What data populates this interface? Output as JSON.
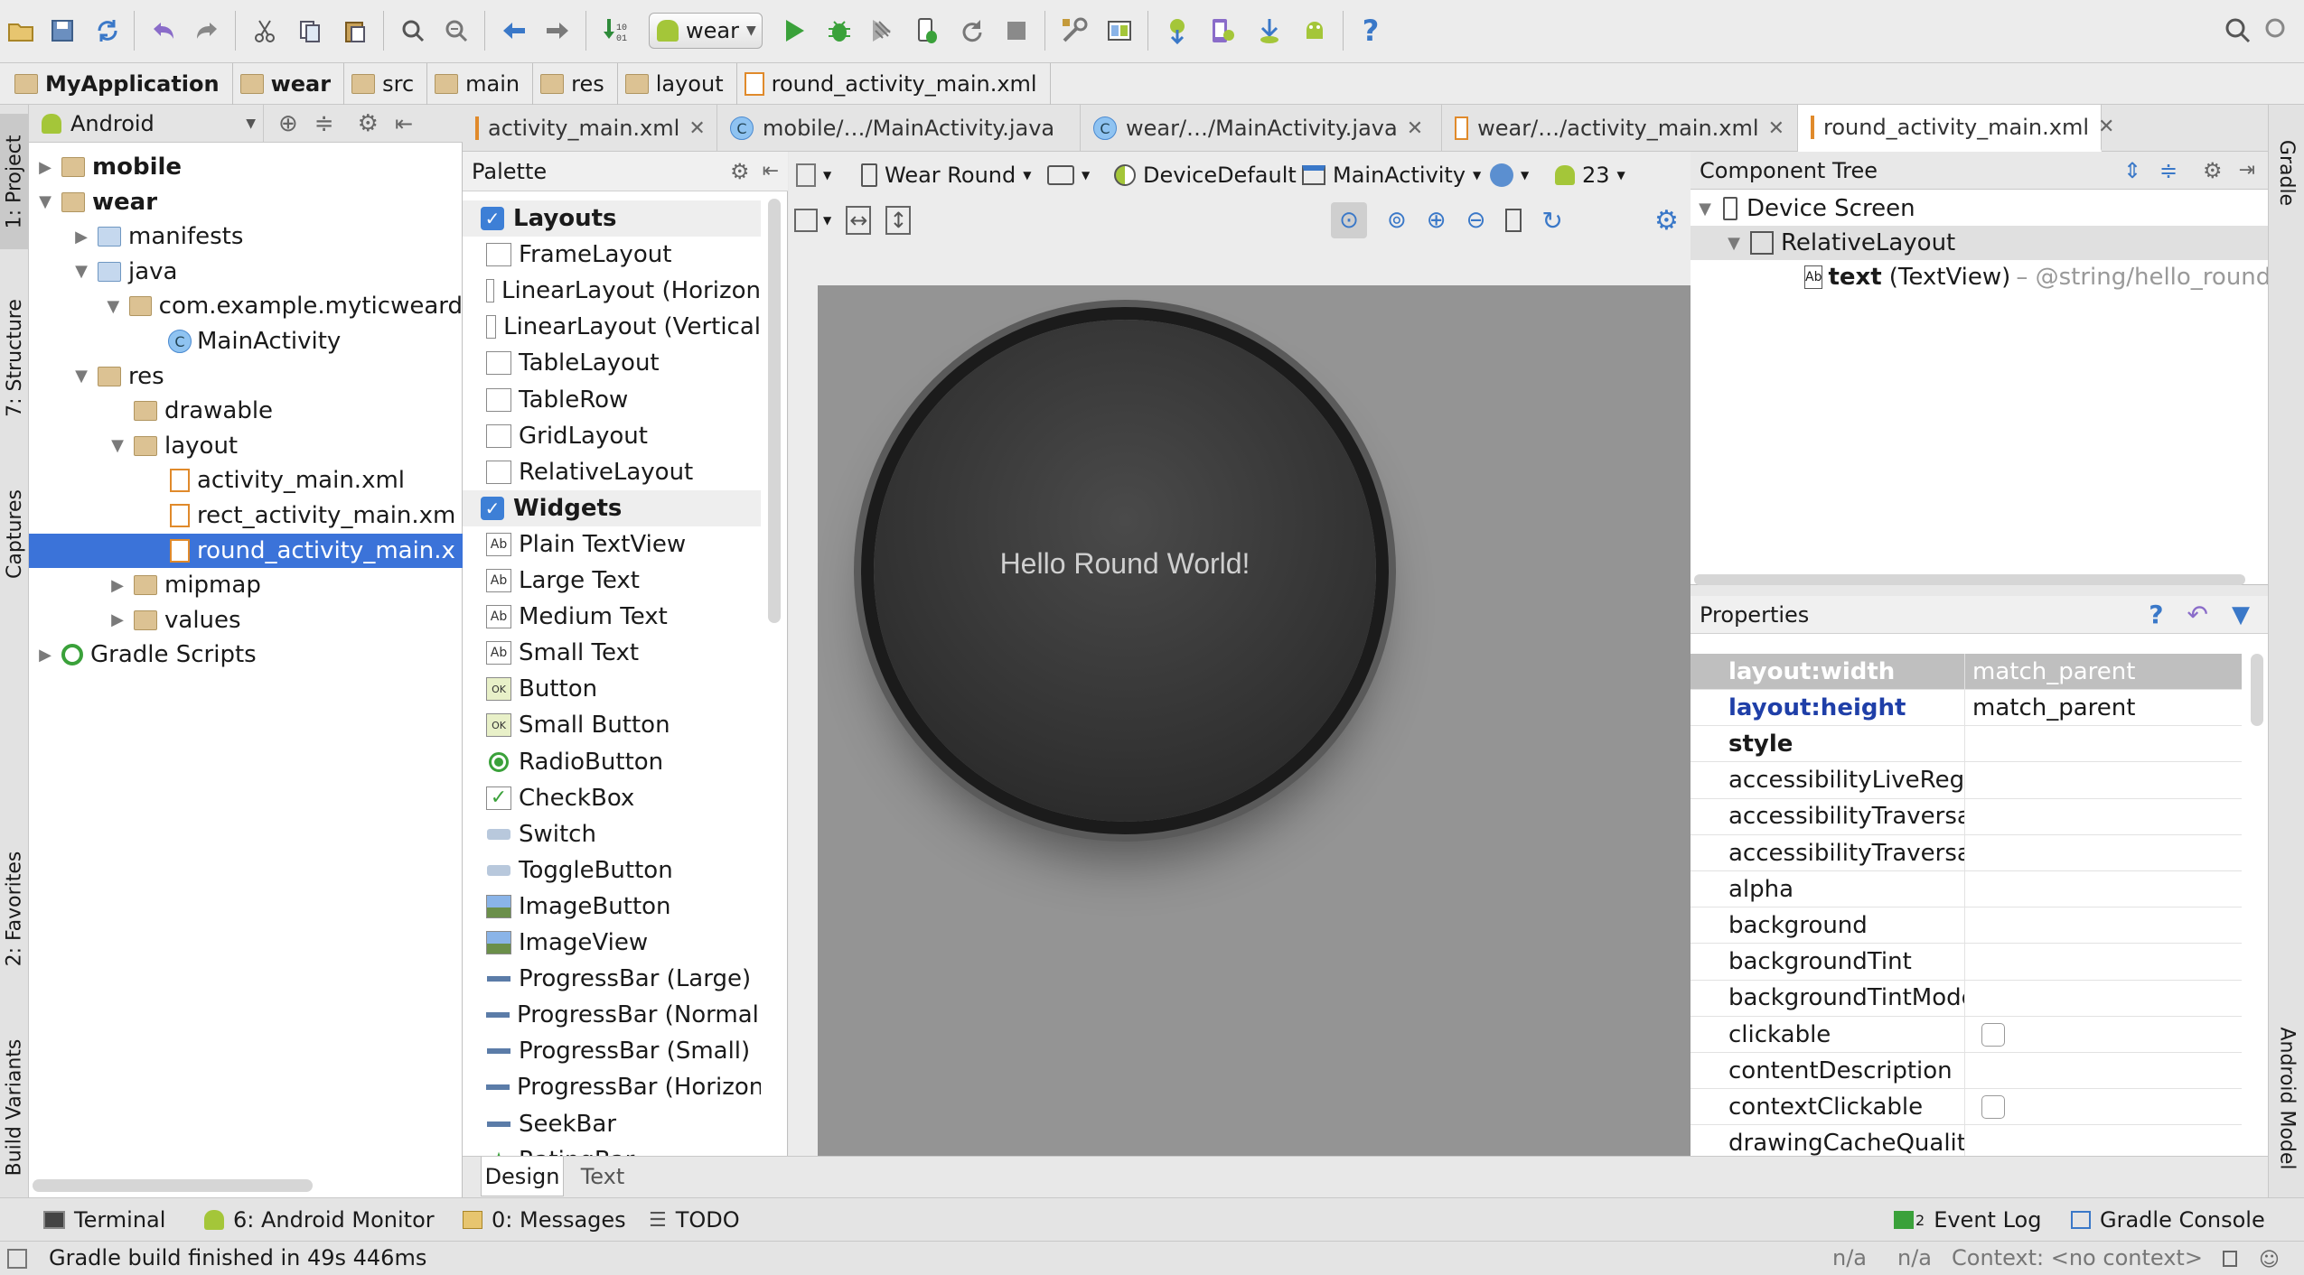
{
  "toolbar": {
    "run_config": "wear"
  },
  "breadcrumb": [
    "MyApplication",
    "wear",
    "src",
    "main",
    "res",
    "layout",
    "round_activity_main.xml"
  ],
  "project_panel": {
    "view_mode": "Android",
    "tree": [
      {
        "label": "mobile",
        "level": 0,
        "bold": true,
        "expanded": false,
        "icon": "module-folder"
      },
      {
        "label": "wear",
        "level": 0,
        "bold": true,
        "expanded": true,
        "icon": "module-folder"
      },
      {
        "label": "manifests",
        "level": 1,
        "expanded": false,
        "icon": "folder-blue"
      },
      {
        "label": "java",
        "level": 1,
        "expanded": true,
        "icon": "folder-blue"
      },
      {
        "label": "com.example.myticweard",
        "level": 2,
        "expanded": true,
        "icon": "package-folder"
      },
      {
        "label": "MainActivity",
        "level": 3,
        "icon": "class"
      },
      {
        "label": "res",
        "level": 1,
        "expanded": true,
        "icon": "res-folder"
      },
      {
        "label": "drawable",
        "level": 2,
        "icon": "folder"
      },
      {
        "label": "layout",
        "level": 2,
        "expanded": true,
        "icon": "folder"
      },
      {
        "label": "activity_main.xml",
        "level": 3,
        "icon": "xml"
      },
      {
        "label": "rect_activity_main.xm",
        "level": 3,
        "icon": "xml"
      },
      {
        "label": "round_activity_main.x",
        "level": 3,
        "icon": "xml",
        "selected": true
      },
      {
        "label": "mipmap",
        "level": 2,
        "expanded": false,
        "icon": "folder"
      },
      {
        "label": "values",
        "level": 2,
        "expanded": false,
        "icon": "folder"
      },
      {
        "label": "Gradle Scripts",
        "level": 0,
        "expanded": false,
        "icon": "gradle"
      }
    ]
  },
  "editor_tabs": [
    {
      "label": "activity_main.xml",
      "icon": "xml"
    },
    {
      "label": "mobile/…/MainActivity.java",
      "icon": "class"
    },
    {
      "label": "wear/…/MainActivity.java",
      "icon": "class"
    },
    {
      "label": "wear/…/activity_main.xml",
      "icon": "xml"
    },
    {
      "label": "round_activity_main.xml",
      "icon": "xml",
      "active": true
    }
  ],
  "palette": {
    "title": "Palette",
    "items": [
      {
        "label": "Layouts",
        "header": true
      },
      {
        "label": "FrameLayout",
        "icon": "frame"
      },
      {
        "label": "LinearLayout (Horizon",
        "icon": "linear-h"
      },
      {
        "label": "LinearLayout (Vertical",
        "icon": "linear-v"
      },
      {
        "label": "TableLayout",
        "icon": "table"
      },
      {
        "label": "TableRow",
        "icon": "table-row"
      },
      {
        "label": "GridLayout",
        "icon": "grid"
      },
      {
        "label": "RelativeLayout",
        "icon": "relative"
      },
      {
        "label": "Widgets",
        "header": true
      },
      {
        "label": "Plain TextView",
        "icon": "Ab"
      },
      {
        "label": "Large Text",
        "icon": "Ab"
      },
      {
        "label": "Medium Text",
        "icon": "Ab"
      },
      {
        "label": "Small Text",
        "icon": "Ab"
      },
      {
        "label": "Button",
        "icon": "OK"
      },
      {
        "label": "Small Button",
        "icon": "OK"
      },
      {
        "label": "RadioButton",
        "icon": "radio"
      },
      {
        "label": "CheckBox",
        "icon": "check"
      },
      {
        "label": "Switch",
        "icon": "switch"
      },
      {
        "label": "ToggleButton",
        "icon": "toggle"
      },
      {
        "label": "ImageButton",
        "icon": "image"
      },
      {
        "label": "ImageView",
        "icon": "image"
      },
      {
        "label": "ProgressBar (Large)",
        "icon": "progress"
      },
      {
        "label": "ProgressBar (Normal)",
        "icon": "progress"
      },
      {
        "label": "ProgressBar (Small)",
        "icon": "progress"
      },
      {
        "label": "ProgressBar (Horizont",
        "icon": "progress"
      },
      {
        "label": "SeekBar",
        "icon": "seek"
      },
      {
        "label": "RatingBar",
        "icon": "star"
      }
    ]
  },
  "design_toolbar": {
    "device": "Wear Round",
    "theme": "DeviceDefault",
    "activity": "MainActivity",
    "api": "23"
  },
  "preview": {
    "text": "Hello Round World!"
  },
  "component_tree": {
    "title": "Component Tree",
    "nodes": [
      {
        "label": "Device Screen",
        "level": 0
      },
      {
        "label": "RelativeLayout",
        "level": 1,
        "selected": true
      },
      {
        "label": "text",
        "suffix": "(TextView)",
        "ref": " – @string/hello_round",
        "level": 2
      }
    ]
  },
  "properties": {
    "title": "Properties",
    "rows": [
      {
        "name": "layout:width",
        "value": "match_parent",
        "highlight": true
      },
      {
        "name": "layout:height",
        "value": "match_parent",
        "blue": true
      },
      {
        "name": "style",
        "value": "",
        "bold": true
      },
      {
        "name": "accessibilityLiveRegi",
        "value": ""
      },
      {
        "name": "accessibilityTraversa",
        "value": ""
      },
      {
        "name": "accessibilityTraversa",
        "value": ""
      },
      {
        "name": "alpha",
        "value": ""
      },
      {
        "name": "background",
        "value": ""
      },
      {
        "name": "backgroundTint",
        "value": ""
      },
      {
        "name": "backgroundTintMode",
        "value": ""
      },
      {
        "name": "clickable",
        "value": "",
        "checkbox": true
      },
      {
        "name": "contentDescription",
        "value": ""
      },
      {
        "name": "contextClickable",
        "value": "",
        "checkbox": true
      },
      {
        "name": "drawingCacheQuality",
        "value": ""
      }
    ]
  },
  "bottom_tabs": {
    "design": "Design",
    "text": "Text"
  },
  "tool_windows": {
    "terminal": "Terminal",
    "android_monitor": "6: Android Monitor",
    "messages": "0: Messages",
    "todo": "TODO",
    "event_log": "Event Log",
    "event_log_count": "2",
    "gradle_console": "Gradle Console"
  },
  "side_tabs": {
    "project": "1: Project",
    "structure": "7: Structure",
    "captures": "Captures",
    "favorites": "2: Favorites",
    "build_variants": "Build Variants",
    "gradle": "Gradle",
    "android_model": "Android Model"
  },
  "status": {
    "message": "Gradle build finished in 49s 446ms",
    "na1": "n/a",
    "na2": "n/a",
    "context": "Context: <no context>"
  },
  "colors": {
    "selection": "#3b73d9",
    "android_green": "#a4c639",
    "run_green": "#3aa13a",
    "canvas": "#949494"
  }
}
